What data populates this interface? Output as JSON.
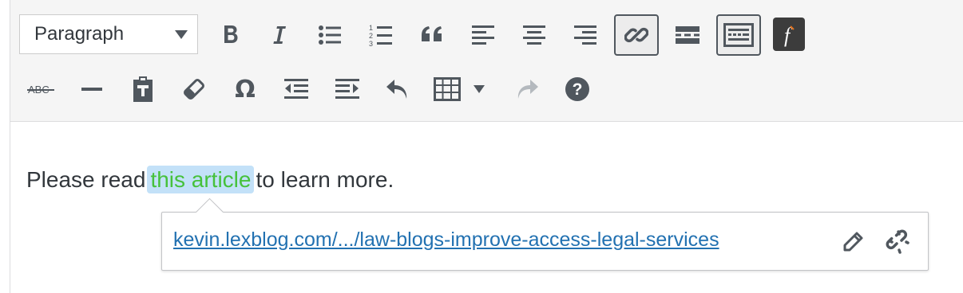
{
  "toolbar": {
    "format_select": {
      "value": "Paragraph"
    },
    "row1": [
      {
        "name": "bold-button",
        "icon": "bold-icon"
      },
      {
        "name": "italic-button",
        "icon": "italic-icon"
      },
      {
        "name": "bulleted-list-button",
        "icon": "bulleted-list-icon"
      },
      {
        "name": "numbered-list-button",
        "icon": "numbered-list-icon"
      },
      {
        "name": "blockquote-button",
        "icon": "blockquote-icon"
      },
      {
        "name": "align-left-button",
        "icon": "align-left-icon"
      },
      {
        "name": "align-center-button",
        "icon": "align-center-icon"
      },
      {
        "name": "align-right-button",
        "icon": "align-right-icon"
      },
      {
        "name": "insert-link-button",
        "icon": "link-icon",
        "active": true
      },
      {
        "name": "read-more-button",
        "icon": "read-more-icon"
      },
      {
        "name": "toolbar-toggle-button",
        "icon": "keyboard-icon",
        "active": true
      },
      {
        "name": "plugin-f-button",
        "icon": "f-logo-icon"
      }
    ],
    "row2": [
      {
        "name": "strikethrough-button",
        "icon": "strikethrough-icon",
        "label": "ABC"
      },
      {
        "name": "horizontal-line-button",
        "icon": "horizontal-line-icon"
      },
      {
        "name": "paste-as-text-button",
        "icon": "paste-text-icon"
      },
      {
        "name": "clear-formatting-button",
        "icon": "eraser-icon"
      },
      {
        "name": "special-character-button",
        "icon": "omega-icon",
        "label": "Ω"
      },
      {
        "name": "decrease-indent-button",
        "icon": "outdent-icon"
      },
      {
        "name": "increase-indent-button",
        "icon": "indent-icon"
      },
      {
        "name": "undo-button",
        "icon": "undo-icon"
      },
      {
        "name": "table-button",
        "icon": "table-icon"
      },
      {
        "name": "redo-button",
        "icon": "redo-icon",
        "disabled": true
      },
      {
        "name": "help-button",
        "icon": "help-icon"
      }
    ]
  },
  "content": {
    "before": "Please read",
    "link_text": "this article",
    "after": "to learn more."
  },
  "link_popup": {
    "url": "kevin.lexblog.com/.../law-blogs-improve-access-legal-services",
    "edit_icon": "pencil-icon",
    "unlink_icon": "unlink-icon"
  },
  "colors": {
    "toolbar_bg": "#f5f5f5",
    "icon": "#50575e",
    "link": "#2271b1",
    "selection_bg": "#c3e1f8",
    "selection_text": "#46c13b",
    "f_logo_bg": "#3c3c3c",
    "f_logo_accent": "#e2711d"
  }
}
